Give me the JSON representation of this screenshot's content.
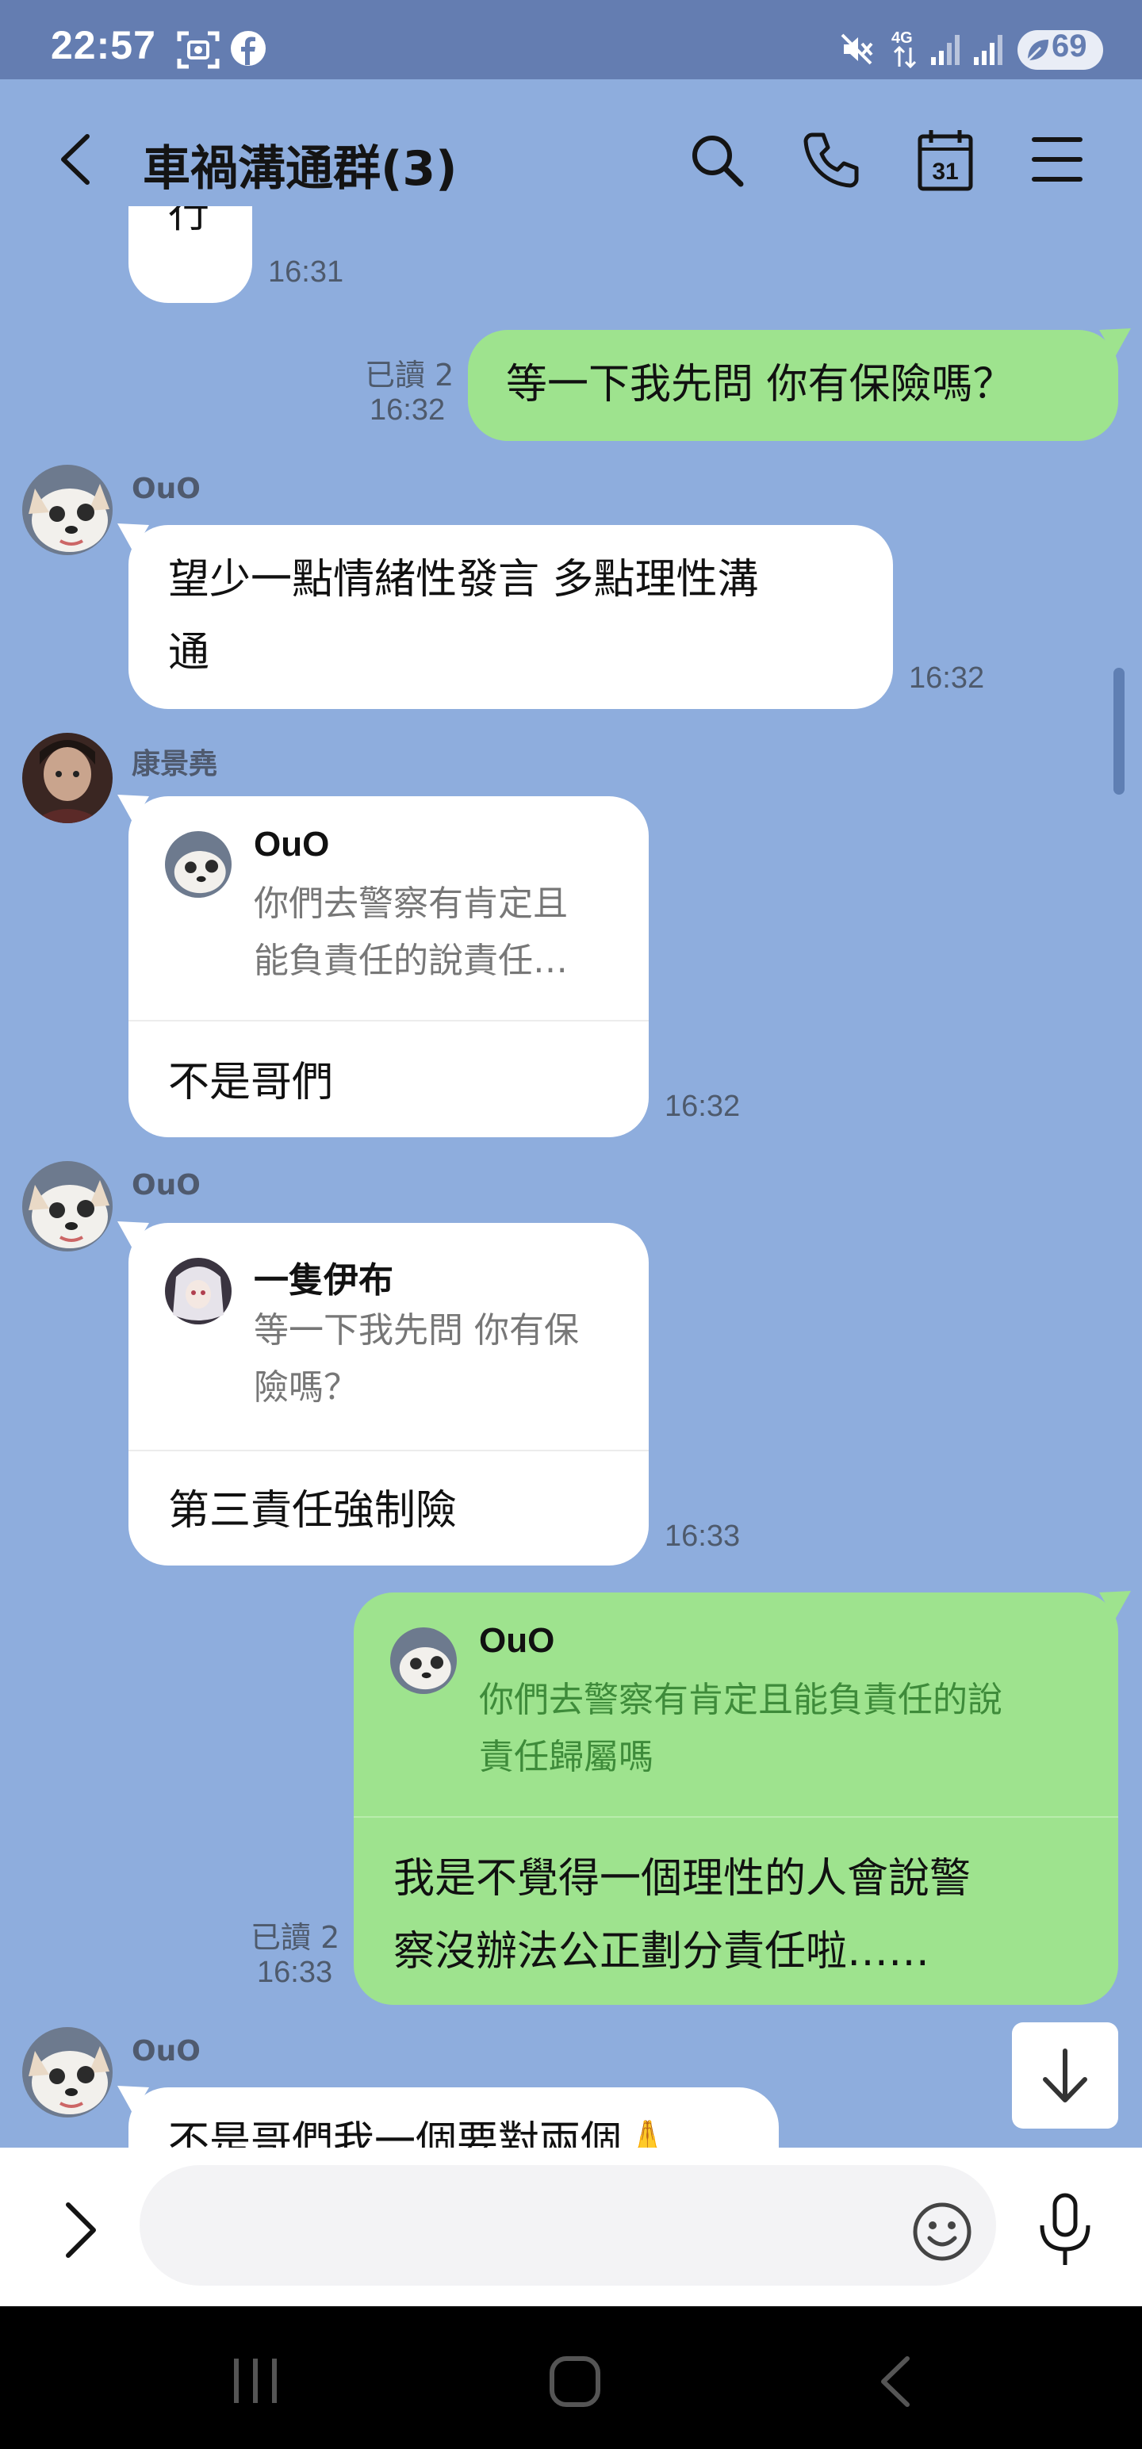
{
  "status_bar": {
    "time": "22:57",
    "battery": "69",
    "icons": [
      "screenshot-icon",
      "facebook-icon",
      "mute-icon",
      "network-4g-icon",
      "signal-icon",
      "signal-icon",
      "battery-icon"
    ]
  },
  "header": {
    "title": "車禍溝通群(3)",
    "icons": [
      "back-icon",
      "search-icon",
      "phone-icon",
      "calendar-icon",
      "menu-icon"
    ],
    "calendar_day": "31"
  },
  "messages": [
    {
      "sender": "",
      "text": "行",
      "time": "16:31"
    },
    {
      "sender": "me",
      "read": "已讀 2",
      "time": "16:32",
      "text": "等一下我先問 你有保險嗎？"
    },
    {
      "sender": "OuO",
      "text_lines": [
        "望少一點情緒性發言 多點理性溝",
        "通"
      ],
      "time": "16:32"
    },
    {
      "sender": "康景堯",
      "quote_name": "OuO",
      "quote_lines": [
        "你們去警察有肯定且",
        "能負責任的說責任…"
      ],
      "text": "不是哥們",
      "time": "16:32"
    },
    {
      "sender": "OuO",
      "quote_name": "一隻伊布",
      "quote_lines": [
        "等一下我先問 你有保",
        "險嗎？"
      ],
      "text": "第三責任強制險",
      "time": "16:33"
    },
    {
      "sender": "me",
      "read": "已讀 2",
      "time": "16:33",
      "quote_name": "OuO",
      "quote_lines": [
        "你們去警察有肯定且能負責任的說",
        "責任歸屬嗎"
      ],
      "text_lines": [
        "我是不覺得一個理性的人會說警",
        "察沒辦法公正劃分責任啦……"
      ]
    },
    {
      "sender": "OuO",
      "text": "不是哥們我一個要對兩個🙏"
    }
  ],
  "input_bar": {
    "placeholder": "",
    "icons": [
      "expand-icon",
      "emoji-icon",
      "mic-icon"
    ]
  },
  "nav_bar": {
    "icons": [
      "recent-apps-icon",
      "home-icon",
      "nav-back-icon"
    ]
  },
  "colors": {
    "status_bar": "#647db1",
    "chat_background": "#8eaddd",
    "my_bubble": "#9ee38e",
    "other_bubble": "#ffffff"
  }
}
